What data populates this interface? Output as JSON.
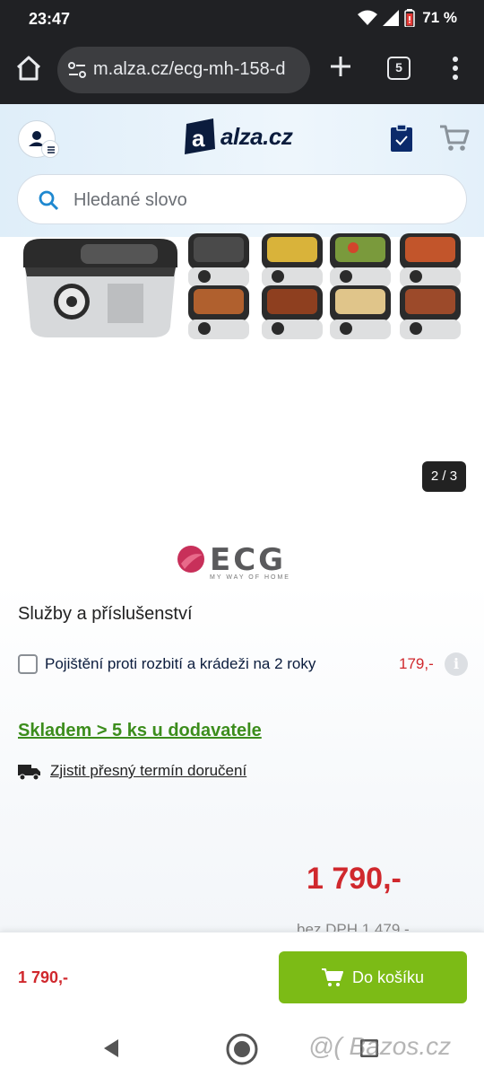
{
  "status_bar": {
    "time": "23:47",
    "battery": "71 %"
  },
  "browser": {
    "url": "m.alza.cz/ecg-mh-158-d",
    "tab_count": "5"
  },
  "header": {
    "logo_text": "alza.cz",
    "search_placeholder": "Hledané slovo"
  },
  "gallery": {
    "counter": "2 / 3"
  },
  "brand": {
    "name": "ECG",
    "tagline": "MY WAY OF HOME"
  },
  "services": {
    "title": "Služby a příslušenství",
    "insurance_label": "Pojištění proti rozbití a krádeži na 2 roky",
    "insurance_price": "179,-",
    "insurance_checked": false
  },
  "availability": {
    "stock_text": "Skladem > 5 ks u dodavatele",
    "delivery_text": "Zjistit přesný termín doručení"
  },
  "price": {
    "main": "1 790,-",
    "without_vat": "bez DPH 1 479,-"
  },
  "sticky_bar": {
    "price": "1 790,-",
    "cart_button_label": "Do košíku"
  },
  "watermark": "@( Bazos.cz",
  "colors": {
    "price_red": "#d0282d",
    "stock_green": "#3c8d1c",
    "cart_green": "#7cbb16",
    "brand_navy": "#0b1c3d"
  }
}
